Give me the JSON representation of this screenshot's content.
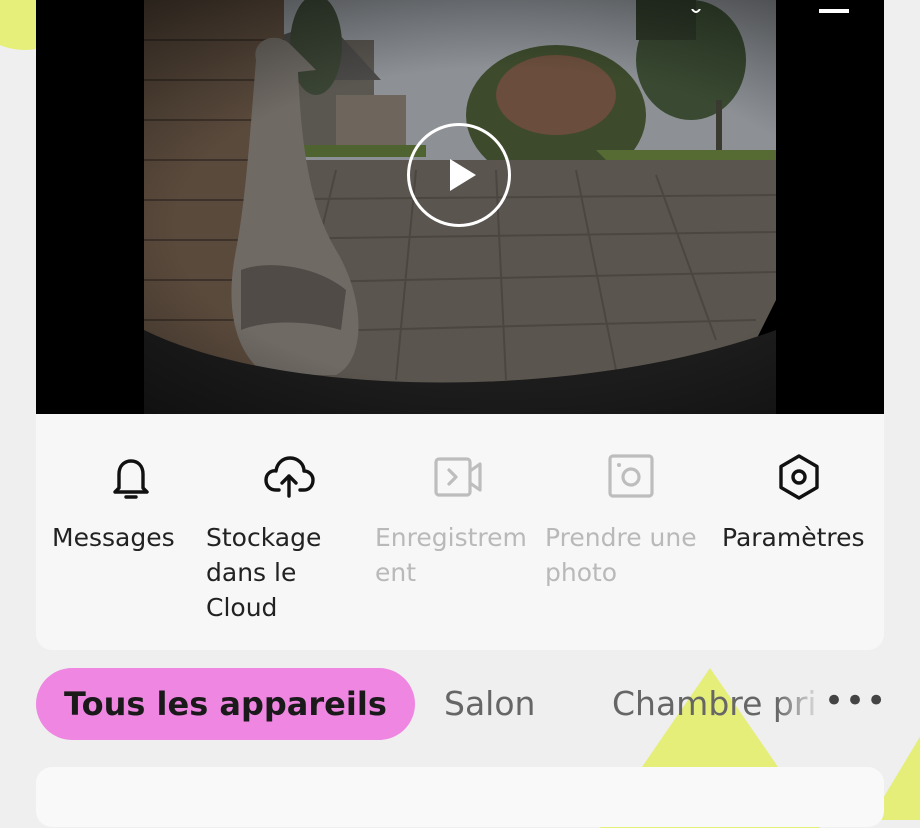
{
  "camera": {
    "actions": [
      {
        "label": "Messages",
        "icon": "bell-icon",
        "enabled": true
      },
      {
        "label": "Stockage dans le Cloud",
        "icon": "cloud-upload-icon",
        "enabled": true
      },
      {
        "label": "Enregistrement",
        "icon": "video-record-icon",
        "enabled": false
      },
      {
        "label": "Prendre une photo",
        "icon": "camera-snapshot-icon",
        "enabled": false
      },
      {
        "label": "Paramètres",
        "icon": "hexagon-settings-icon",
        "enabled": true
      }
    ]
  },
  "tabs": {
    "items": [
      {
        "label": "Tous les appareils",
        "active": true
      },
      {
        "label": "Salon",
        "active": false
      },
      {
        "label": "Chambre pri",
        "active": false
      }
    ],
    "more_label": "•••"
  },
  "colors": {
    "accent_tab": "#ee86e2",
    "decor_yellow": "#e4ee78",
    "background": "#efefef",
    "disabled_text": "#b9b9b9"
  }
}
